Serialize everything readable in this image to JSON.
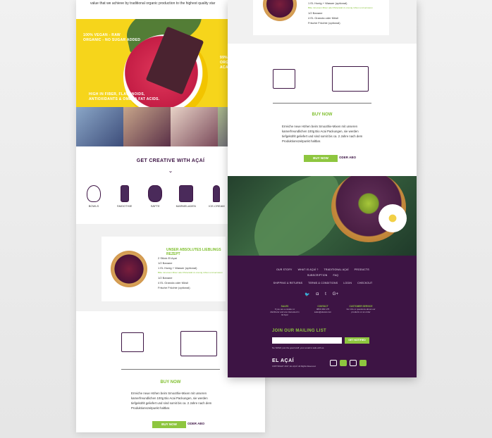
{
  "left_page": {
    "tagline": "value that we achieve by traditional organic production to the highest quality star",
    "hero": {
      "text_top": "100% VEGAN - RAW\nORGANIC - NO SUGAR ADDED",
      "text_right": "99%\nORG\nACA",
      "text_bottom": "HIGH IN FIBER, FLAVONOIDS,\nANTIOXIDANTS & OMEGA FAT ACIDS."
    },
    "creative": {
      "title": "GET CREATIVE WITH AÇAÍ",
      "chevron": "⌄",
      "items": [
        {
          "label": "BOWLS",
          "icon": "bowl-icon"
        },
        {
          "label": "SMOOTHIE",
          "icon": "smoothie-icon"
        },
        {
          "label": "SÄFTE",
          "icon": "juice-icon"
        },
        {
          "label": "MARMELADEN",
          "icon": "jam-jar-icon"
        },
        {
          "label": "ICE-CREAM",
          "icon": "popsicle-icon"
        },
        {
          "label": "FIGAME KUCHEN",
          "icon": "cake-icon"
        }
      ]
    },
    "recipe": {
      "title": "UNSER ABSOLUTES LIEBLINGS REZEPT",
      "lines": [
        "2 Stück El Açaí",
        "1/2 Banane",
        "1 EL Honig + Wasser (optional)",
        "1/2 Banane",
        "4 EL Granola oder Müsli",
        "Frische Früchte (optional)"
      ],
      "green_line": "Bitte mit einem Mixer oder Pürierstab zu cremig rühren und servieren"
    },
    "buy": {
      "title": "BUY NOW",
      "text": "Erreiche neue Höhen beim Smoothie-Mixen mit unseren kamerfreundlichen 100g Bio Acai Packungen, sie werden tiefgekühlt geliefert und sind somit bis ca. 2 Jahre nach dem Produktionszeitpunkt haltbar.",
      "button": "BUY NOW",
      "or": "ODER ABO"
    }
  },
  "right_page": {
    "recipe_lines": [
      "1 EL Honig + Wasser (optional)",
      "1/2 Banane",
      "4 EL Granola oder Müsli",
      "Frische Früchte (optional)"
    ],
    "recipe_green": "Bitte mit einem Mixer oder Pürierstab zu cremig rühren und servieren",
    "buy": {
      "title": "BUY NOW",
      "text": "Erreiche neue Höhen beim Smoothie-Mixen mit unseren kamerfreundlichen 100g Bio Acai Packungen, sie werden tiefgekühlt geliefert und sind somit bis ca. 2 Jahre nach dem Produktionszeitpunkt haltbar.",
      "button": "BUY NOW",
      "or": "ODER ABO"
    },
    "footer": {
      "nav1": [
        "OUR STORY",
        "WHAT IS AÇAÍ ?",
        "TRADITIONAL AÇAÍ",
        "PRODUCTS",
        "SUBSCRIPTION",
        "FAQ"
      ],
      "nav2": [
        "SHIPPING & RETURNS",
        "TERMS & CONDITIONS",
        "LOGIN",
        "CHECKOUT"
      ],
      "social": [
        "t",
        "g+",
        "t",
        "G+"
      ],
      "social_icons": [
        "twitter-icon",
        "instagram-icon",
        "tumblr-icon",
        "google-plus-icon"
      ],
      "col1_title": "SALES",
      "col1_text": "If you are a retailer or distributor and are interested in El Açaí",
      "col2_title": "CONTACT",
      "col2_text": "0800 460 175\nsales@elacai.com",
      "col3_title": "CUSTOMER SERVICE",
      "col3_text": "For info or questions about our products or an order",
      "mailing_title": "JOIN OUR MAILING LIST",
      "mailing_placeholder": "",
      "mailing_button": "GET NOTIFIED",
      "mailing_note": "No SPAM, just the good stuff, your email is safe with us",
      "brand": "EL AÇAÍ",
      "copyright": "COPYRIGHT 2017, EL AÇAÍ. All Rights Reserved."
    }
  },
  "colors": {
    "purple": "#3d1444",
    "green": "#8ec63f",
    "yellow": "#f6d51b"
  }
}
